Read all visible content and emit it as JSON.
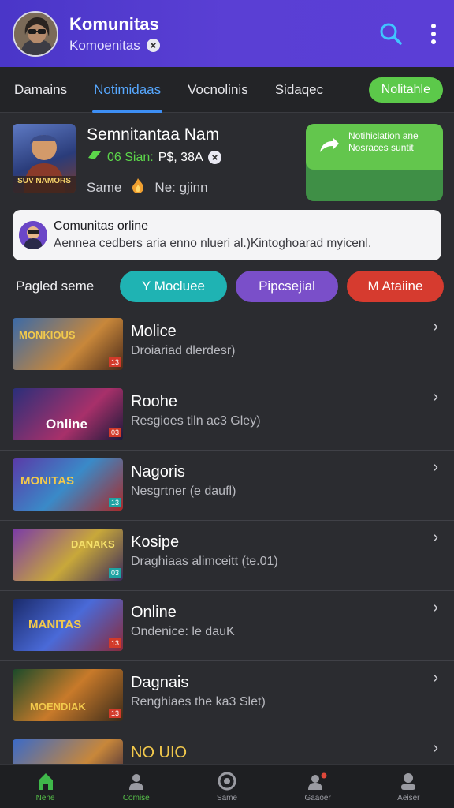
{
  "header": {
    "title": "Komunitas",
    "subtitle": "Komoenitas"
  },
  "tabs": [
    "Damains",
    "Notimidaas",
    "Vocnolinis",
    "Sidaqec"
  ],
  "tab_pill": "Nolitahle",
  "featured": {
    "title": "Semnitantaa Nam",
    "meta_green": "06 Sian:",
    "meta_white": "P$, 38A",
    "left_text": "Same",
    "right_text": "Ne: gjinn",
    "thumb_text": "SUV NAMORS",
    "promo": "Notihiclation ane Nosraces suntit"
  },
  "notice": {
    "title": "Comunitas orline",
    "body": "Aennea cedbers aria enno nlueri al.)Kintoghoarad myicenl."
  },
  "filter": {
    "label": "Pagled seme",
    "chips": [
      {
        "label": "Y  Mocluee",
        "color": "#1fb3b3"
      },
      {
        "label": "Pipcsejial",
        "color": "#7a4fc9"
      },
      {
        "label": "M Ataiine",
        "color": "#d63b2f"
      }
    ]
  },
  "list": [
    {
      "title": "Molice",
      "sub": "Droiariad dlerdesr)",
      "thumb": "MONKIOUS",
      "badge": "13"
    },
    {
      "title": "Roohe",
      "sub": "Resgioes tiln ac3 Gley)",
      "thumb": "Online",
      "badge": "03"
    },
    {
      "title": "Nagoris",
      "sub": "Nesgrtner (e daufl)",
      "thumb": "MONITAS",
      "badge": "13"
    },
    {
      "title": "Kosipe",
      "sub": "Draghiaas alimceitt (te.01)",
      "thumb": "DANAKS",
      "badge": "03"
    },
    {
      "title": "Online",
      "sub": "Ondenice: le dauK",
      "thumb": "MANITAS",
      "badge": "13"
    },
    {
      "title": "Dagnais",
      "sub": "Renghiaes the ka3 Slet)",
      "thumb": "MOENDIAK",
      "badge": "13"
    },
    {
      "title": "NO UIO",
      "sub": "",
      "thumb": "",
      "badge": ""
    }
  ],
  "bottom_nav": [
    "Nene",
    "Comise",
    "Same",
    "Gaaoer",
    "Aeiser"
  ],
  "colors": {
    "header": "#5a3fd4",
    "accent_blue": "#57a8ff",
    "accent_green": "#5cc94a"
  }
}
